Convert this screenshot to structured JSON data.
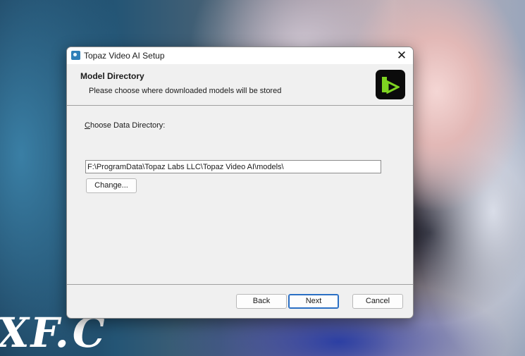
{
  "window": {
    "title": "Topaz Video AI Setup",
    "close_glyph": "✕"
  },
  "banner": {
    "title": "Model Directory",
    "subtitle": "Please choose where downloaded models will be stored",
    "logo_icon": "topaz-play-logo"
  },
  "main": {
    "choose_label_mnemonic": "C",
    "choose_label_rest": "hoose Data Directory:",
    "directory_value": "F:\\ProgramData\\Topaz Labs LLC\\Topaz Video AI\\models\\",
    "change_label": "Change..."
  },
  "footer": {
    "back_label": "Back",
    "next_label": "Next",
    "cancel_label": "Cancel"
  },
  "desktop": {
    "watermark": "XF.C"
  },
  "colors": {
    "logo_green": "#7ed321",
    "dialog_bg": "#f0f0f0",
    "focus_blue": "#2a6fc4"
  }
}
